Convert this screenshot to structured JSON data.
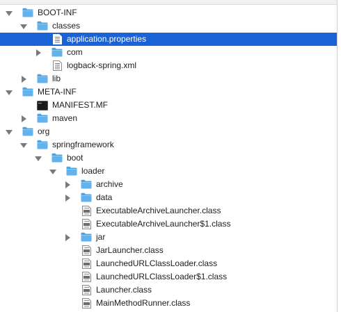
{
  "tree": {
    "rows": [
      {
        "label": "BOOT-INF",
        "depth": 0,
        "type": "folder",
        "expanded": true,
        "has_toggle": true
      },
      {
        "label": "classes",
        "depth": 1,
        "type": "folder",
        "expanded": true,
        "has_toggle": true
      },
      {
        "label": "application.properties",
        "depth": 2,
        "type": "doc",
        "selected": true
      },
      {
        "label": "com",
        "depth": 2,
        "type": "folder",
        "expanded": false,
        "has_toggle": true
      },
      {
        "label": "logback-spring.xml",
        "depth": 2,
        "type": "doc"
      },
      {
        "label": "lib",
        "depth": 1,
        "type": "folder",
        "expanded": false,
        "has_toggle": true
      },
      {
        "label": "META-INF",
        "depth": 0,
        "type": "folder",
        "expanded": true,
        "has_toggle": true
      },
      {
        "label": "MANIFEST.MF",
        "depth": 1,
        "type": "exec"
      },
      {
        "label": "maven",
        "depth": 1,
        "type": "folder",
        "expanded": false,
        "has_toggle": true
      },
      {
        "label": "org",
        "depth": 0,
        "type": "folder",
        "expanded": true,
        "has_toggle": true
      },
      {
        "label": "springframework",
        "depth": 1,
        "type": "folder",
        "expanded": true,
        "has_toggle": true
      },
      {
        "label": "boot",
        "depth": 2,
        "type": "folder",
        "expanded": true,
        "has_toggle": true
      },
      {
        "label": "loader",
        "depth": 3,
        "type": "folder",
        "expanded": true,
        "has_toggle": true
      },
      {
        "label": "archive",
        "depth": 4,
        "type": "folder",
        "expanded": false,
        "has_toggle": true
      },
      {
        "label": "data",
        "depth": 4,
        "type": "folder",
        "expanded": false,
        "has_toggle": true
      },
      {
        "label": "ExecutableArchiveLauncher.class",
        "depth": 4,
        "type": "class"
      },
      {
        "label": "ExecutableArchiveLauncher$1.class",
        "depth": 4,
        "type": "class"
      },
      {
        "label": "jar",
        "depth": 4,
        "type": "folder",
        "expanded": false,
        "has_toggle": true
      },
      {
        "label": "JarLauncher.class",
        "depth": 4,
        "type": "class"
      },
      {
        "label": "LaunchedURLClassLoader.class",
        "depth": 4,
        "type": "class"
      },
      {
        "label": "LaunchedURLClassLoader$1.class",
        "depth": 4,
        "type": "class"
      },
      {
        "label": "Launcher.class",
        "depth": 4,
        "type": "class"
      },
      {
        "label": "MainMethodRunner.class",
        "depth": 4,
        "type": "class"
      }
    ]
  },
  "colors": {
    "selection": "#1963d7",
    "folder_body": "#62b2ec",
    "folder_tab": "#4fa3e3",
    "triangle": "#7a7a7a"
  }
}
